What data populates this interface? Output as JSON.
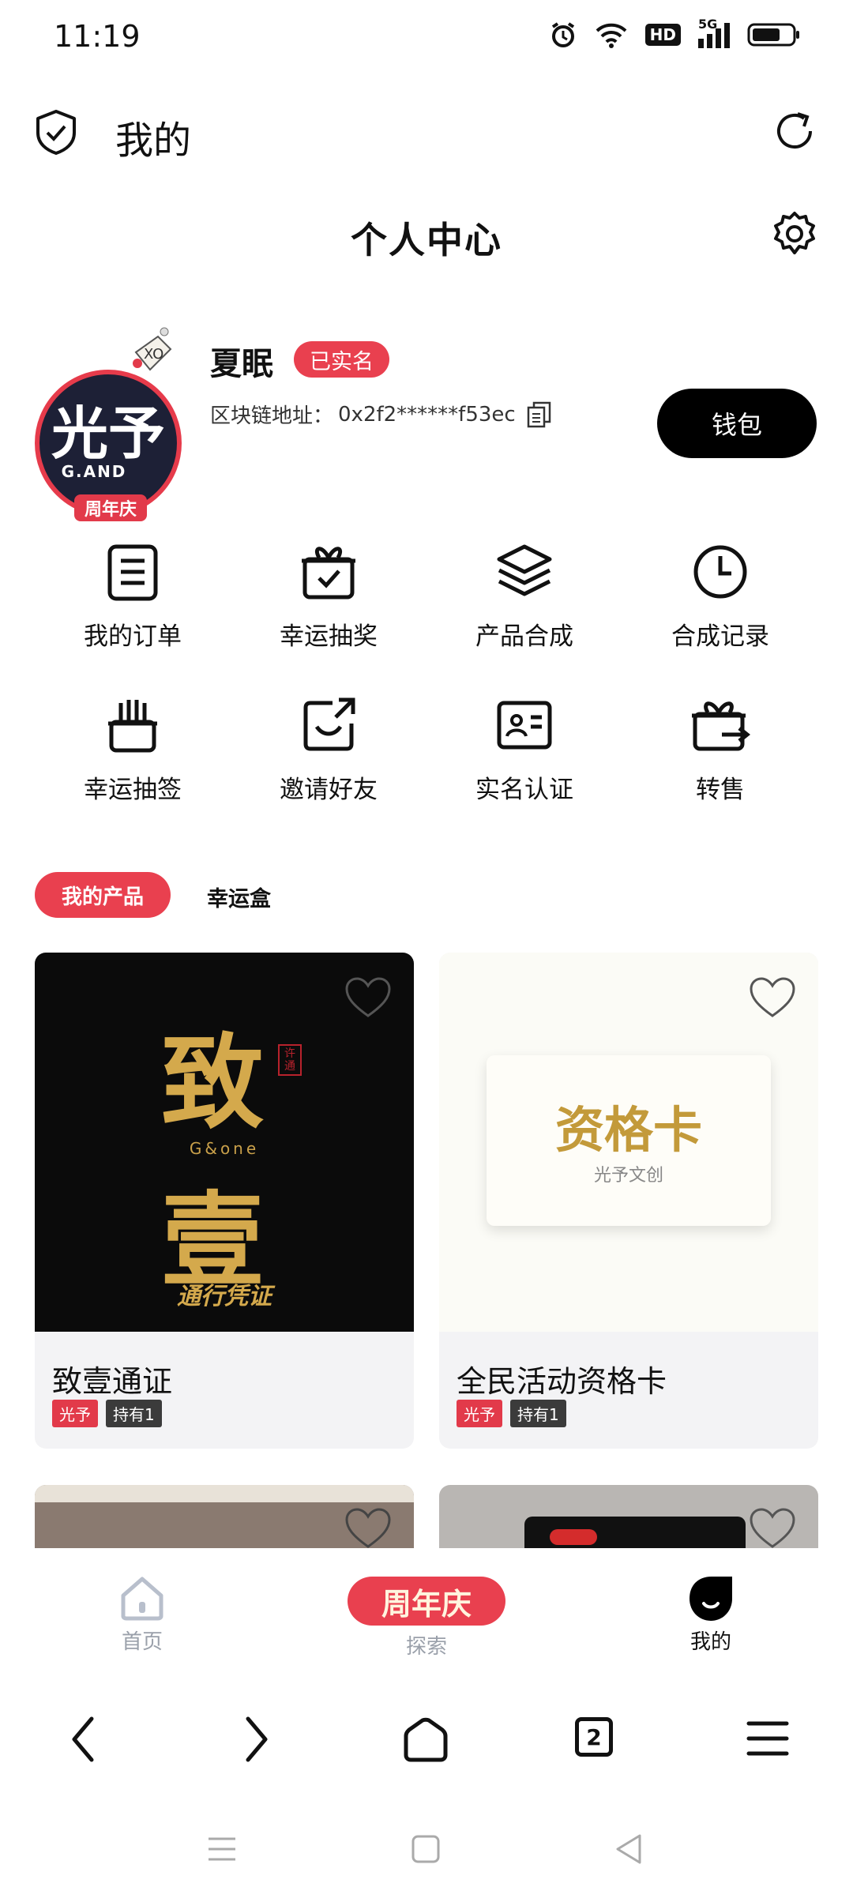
{
  "status": {
    "time": "11:19",
    "battery_label": "HD",
    "network": "5G"
  },
  "header": {
    "title": "我的",
    "page_title": "个人中心"
  },
  "profile": {
    "avatar_text": "光予",
    "avatar_sub": "G.AND",
    "avatar_tag": "周年庆",
    "name": "夏眠",
    "verified": "已实名",
    "chain_label": "区块链地址：",
    "chain_address": "0x2f2******f53ec",
    "wallet_button": "钱包"
  },
  "menu": [
    {
      "label": "我的订单",
      "icon": "order-list-icon"
    },
    {
      "label": "幸运抽奖",
      "icon": "gift-icon"
    },
    {
      "label": "产品合成",
      "icon": "layers-icon"
    },
    {
      "label": "合成记录",
      "icon": "clock-icon"
    },
    {
      "label": "幸运抽签",
      "icon": "lottery-icon"
    },
    {
      "label": "邀请好友",
      "icon": "invite-icon"
    },
    {
      "label": "实名认证",
      "icon": "id-card-icon"
    },
    {
      "label": "转售",
      "icon": "resale-icon"
    }
  ],
  "tabs": {
    "active": "我的产品",
    "other": "幸运盒"
  },
  "products": [
    {
      "title": "致壹通证",
      "brand": "光予",
      "held": "持有1",
      "art": {
        "top": "致",
        "mid": "G&one",
        "bottom": "壹",
        "caption": "通行凭证",
        "seal": "许通"
      }
    },
    {
      "title": "全民活动资格卡",
      "brand": "光予",
      "held": "持有1",
      "art": {
        "title": "资格卡",
        "subtitle": "光予文创"
      }
    }
  ],
  "bottom_tabs": {
    "home": "首页",
    "promo": "周年庆",
    "explore": "探索",
    "mine": "我的"
  },
  "browser": {
    "tab_count": "2"
  },
  "colors": {
    "accent": "#e9404f",
    "dark": "#000000",
    "gold": "#c9a04a"
  }
}
